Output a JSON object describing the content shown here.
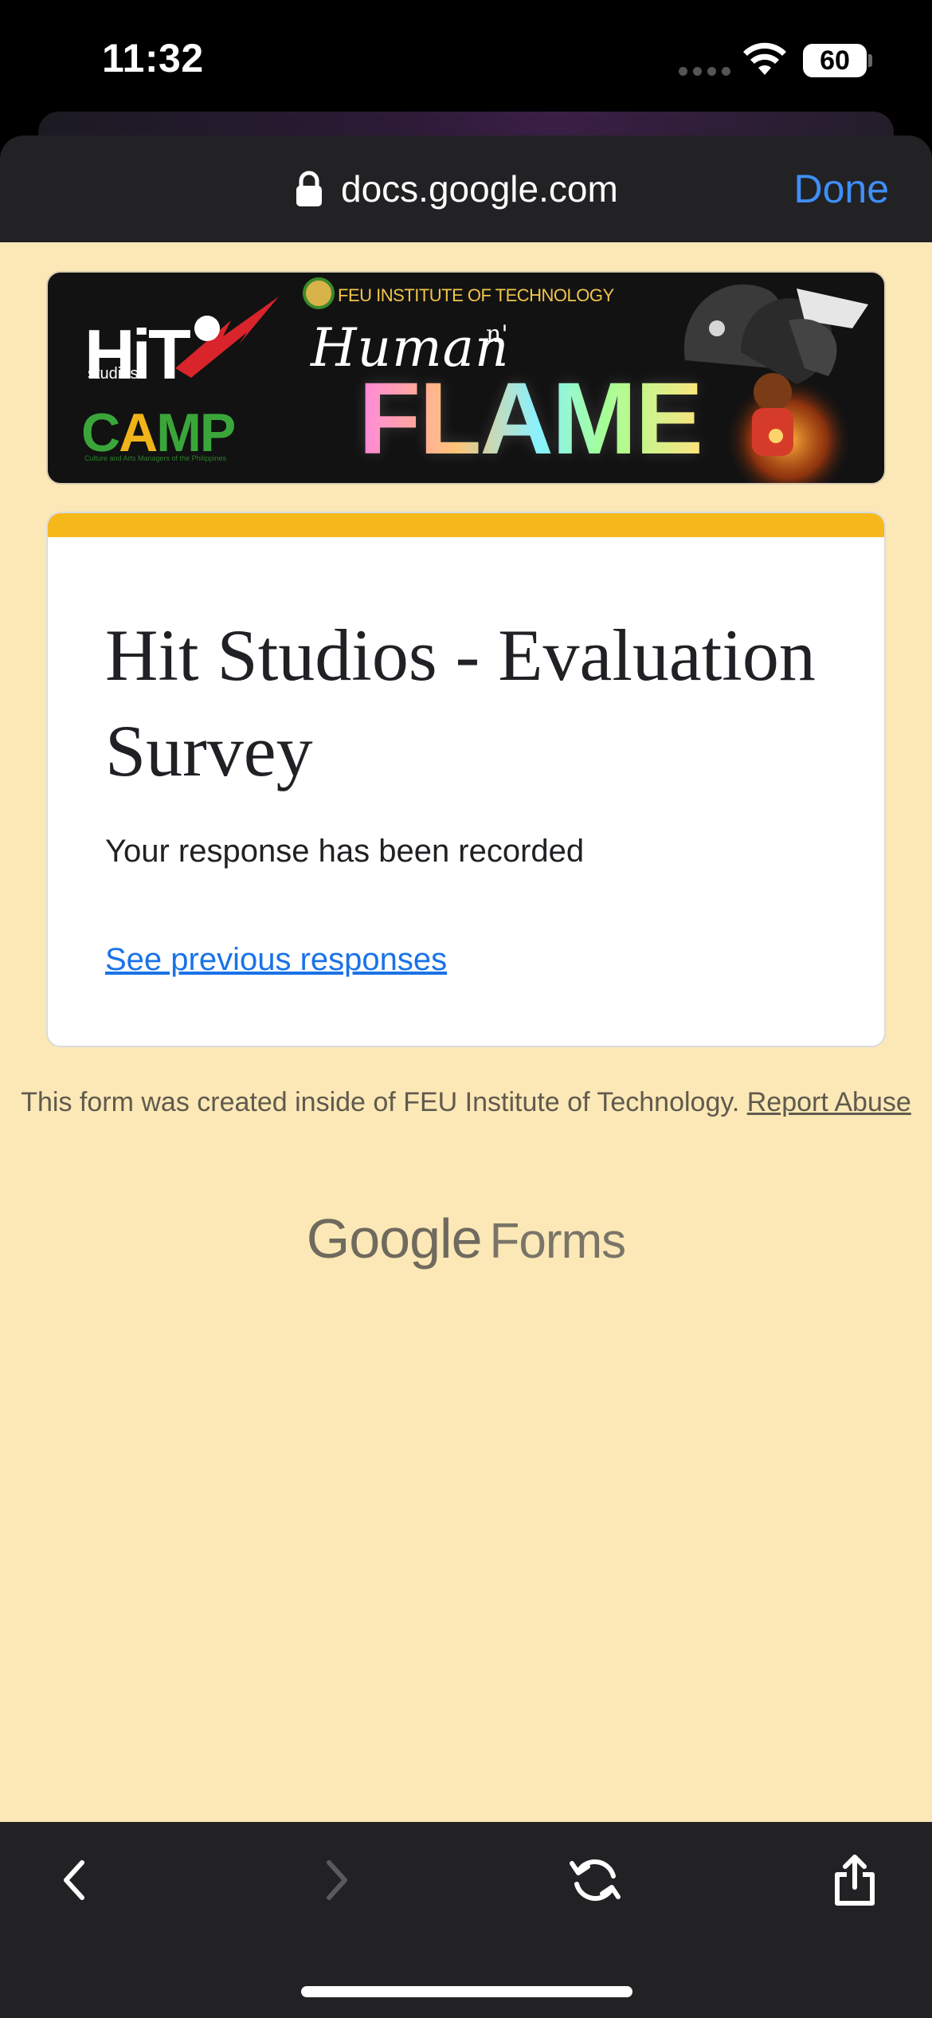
{
  "status_bar": {
    "time": "11:32",
    "battery": "60",
    "icons": [
      "signal-dots-icon",
      "wifi-icon",
      "battery-icon"
    ]
  },
  "browser": {
    "url": "docs.google.com",
    "done_label": "Done",
    "lock_icon": "lock-icon"
  },
  "banner": {
    "hit_logo": "HiT",
    "hit_sub": "studios",
    "camp_logo_c": "C",
    "camp_logo_a": "A",
    "camp_logo_mp": "MP",
    "camp_sub": "Culture and Arts Managers of the Philippines",
    "institution": "FEU INSTITUTE OF TECHNOLOGY",
    "human_text": "Human",
    "n_text": "n'",
    "flame_text": "FLAME"
  },
  "form": {
    "title": "Hit Studios - Evaluation Survey",
    "confirmation": "Your response has been recorded",
    "previous_link": "See previous responses",
    "accent_color": "#f6b81a"
  },
  "footer": {
    "note": "This form was created inside of FEU Institute of Technology.",
    "report_link": "Report Abuse",
    "brand_google": "Google",
    "brand_forms": "Forms"
  },
  "toolbar": {
    "items": [
      "back-icon",
      "forward-icon",
      "reload-icon",
      "share-icon"
    ]
  },
  "colors": {
    "page_background": "#fce8b6",
    "link": "#1a73e8",
    "done": "#3f8ff7",
    "browser_chrome": "#222224"
  }
}
